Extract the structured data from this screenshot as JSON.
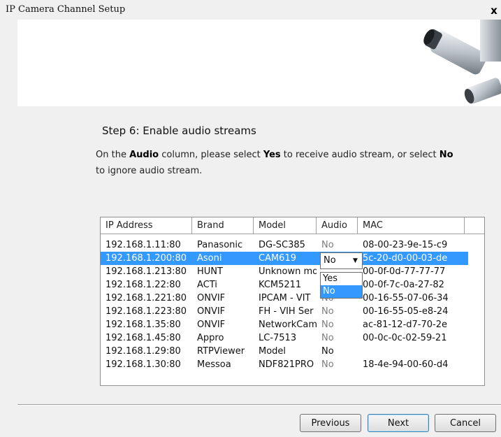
{
  "window": {
    "title": "IP Camera Channel Setup",
    "close_symbol": "x"
  },
  "step": {
    "title": "Step 6: Enable audio streams",
    "instr_1": "On the",
    "instr_audio": "Audio",
    "instr_2": "column, please select",
    "instr_yes": "Yes",
    "instr_3": "to receive audio stream, or select",
    "instr_no": "No",
    "instr_4": "to ignore audio stream."
  },
  "table": {
    "columns": [
      "IP Address",
      "Brand",
      "Model",
      "Audio",
      "MAC"
    ],
    "rows": [
      {
        "ip": "192.168.1.11:80",
        "brand": "Panasonic",
        "model": "DG-SC385",
        "audio": "No",
        "mac": "08-00-23-9e-15-c9"
      },
      {
        "ip": "192.168.1.200:80",
        "brand": "Asoni",
        "model": "CAM619",
        "audio": "No",
        "mac": "5c-20-d0-00-03-de"
      },
      {
        "ip": "192.168.1.213:80",
        "brand": "HUNT",
        "model": "Unknown mo",
        "audio": "",
        "mac": "00-0f-0d-77-77-77"
      },
      {
        "ip": "192.168.1.22:80",
        "brand": "ACTi",
        "model": "KCM5211",
        "audio": "",
        "mac": "00-0f-7c-0a-27-82"
      },
      {
        "ip": "192.168.1.221:80",
        "brand": "ONVIF",
        "model": "IPCAM - VIT",
        "audio": "No",
        "mac": "00-16-55-07-06-34"
      },
      {
        "ip": "192.168.1.223:80",
        "brand": "ONVIF",
        "model": "FH - VIH Ser",
        "audio": "No",
        "mac": "00-16-55-05-e8-24"
      },
      {
        "ip": "192.168.1.35:80",
        "brand": "ONVIF",
        "model": "NetworkCam",
        "audio": "No",
        "mac": "ac-81-12-d7-70-2e"
      },
      {
        "ip": "192.168.1.45:80",
        "brand": "Appro",
        "model": "LC-7513",
        "audio": "No",
        "mac": "00-0c-0c-02-59-21"
      },
      {
        "ip": "192.168.1.29:80",
        "brand": "RTPViewer",
        "model": "Model",
        "audio": "No",
        "mac": ""
      },
      {
        "ip": "192.168.1.30:80",
        "brand": "Messoa",
        "model": "NDF821PRO",
        "audio": "No",
        "mac": "18-4e-94-00-60-d4"
      }
    ],
    "selected_row": 1
  },
  "audio_combo": {
    "value": "No",
    "options": [
      "Yes",
      "No"
    ],
    "highlighted": "No"
  },
  "buttons": {
    "previous": "Previous",
    "next": "Next",
    "cancel": "Cancel"
  }
}
